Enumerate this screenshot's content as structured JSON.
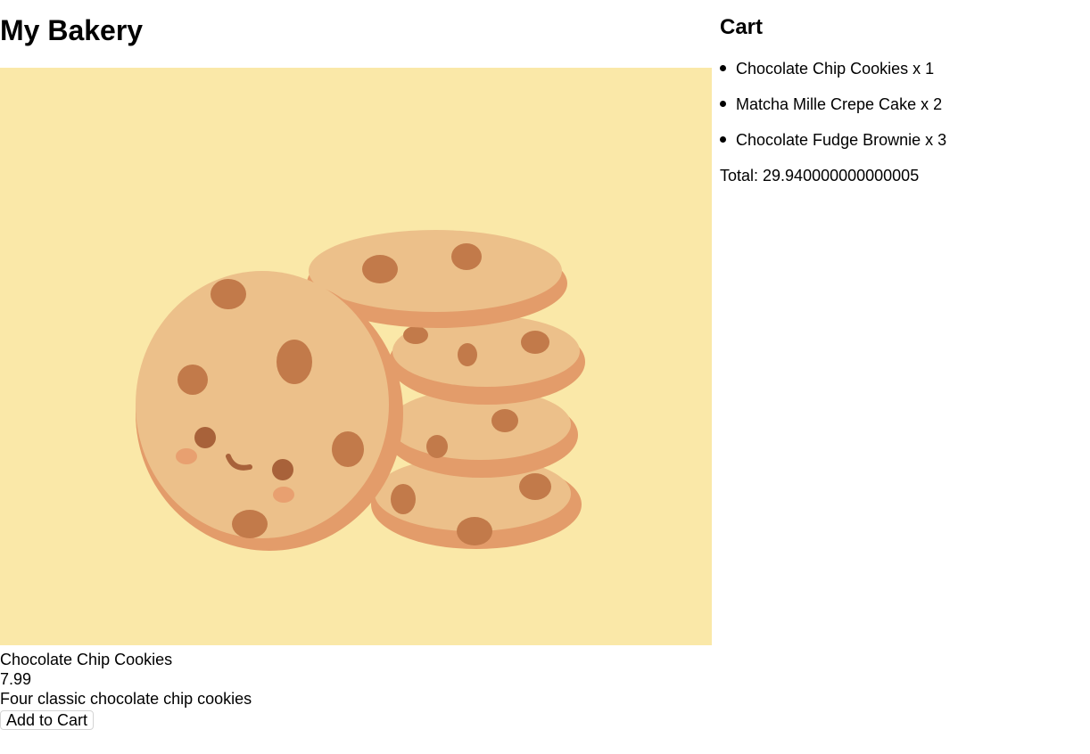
{
  "header": {
    "title": "My Bakery"
  },
  "product": {
    "name": "Chocolate Chip Cookies",
    "price": "7.99",
    "description": "Four classic chocolate chip cookies",
    "add_button_label": "Add to Cart",
    "image_icon": "chocolate-chip-cookies-illustration",
    "image_background": "#fae8a8"
  },
  "cart": {
    "title": "Cart",
    "items": [
      {
        "label": "Chocolate Chip Cookies x 1"
      },
      {
        "label": "Matcha Mille Crepe Cake x 2"
      },
      {
        "label": "Chocolate Fudge Brownie x 3"
      }
    ],
    "total": "Total: 29.940000000000005"
  }
}
